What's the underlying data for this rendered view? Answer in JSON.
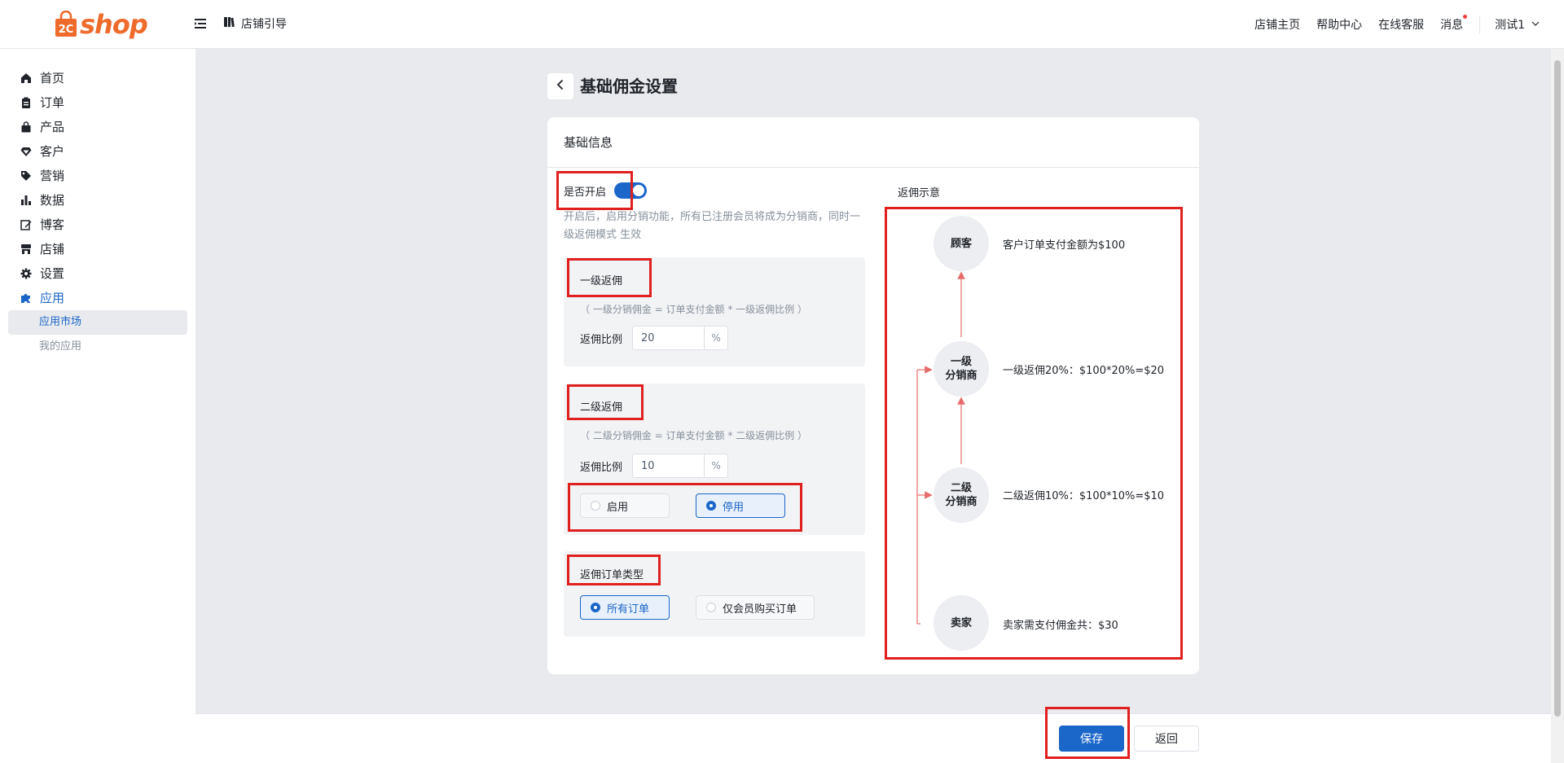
{
  "topbar": {
    "logo_text": "shop",
    "logo_mark_text": "2C",
    "guide_label": "店铺引导",
    "links": [
      "店铺主页",
      "帮助中心",
      "在线客服",
      "消息"
    ],
    "user_name": "测试1"
  },
  "sidebar": {
    "items": [
      {
        "label": "首页",
        "icon": "home-icon"
      },
      {
        "label": "订单",
        "icon": "clipboard-icon"
      },
      {
        "label": "产品",
        "icon": "bag-icon"
      },
      {
        "label": "客户",
        "icon": "diamond-icon"
      },
      {
        "label": "营销",
        "icon": "tag-icon"
      },
      {
        "label": "数据",
        "icon": "bar-chart-icon"
      },
      {
        "label": "博客",
        "icon": "edit-icon"
      },
      {
        "label": "店铺",
        "icon": "store-icon"
      },
      {
        "label": "设置",
        "icon": "gear-icon"
      },
      {
        "label": "应用",
        "icon": "puzzle-icon"
      }
    ],
    "sub_items": [
      {
        "label": "应用市场",
        "active": true
      },
      {
        "label": "我的应用",
        "active": false
      }
    ]
  },
  "page": {
    "title": "基础佣金设置"
  },
  "card": {
    "title": "基础信息",
    "enable_label": "是否开启",
    "enable_on": true,
    "enable_desc": "开启后，启用分销功能，所有已注册会员将成为分销商，同时一级返佣模式 生效",
    "level1": {
      "title": "一级返佣",
      "formula": "（ 一级分销佣金 = 订单支付金额 * 一级返佣比例 ）",
      "rate_label": "返佣比例",
      "rate_value": "20",
      "unit": "%"
    },
    "level2": {
      "title": "二级返佣",
      "formula": "（ 二级分销佣金 = 订单支付金额 * 二级返佣比例 ）",
      "rate_label": "返佣比例",
      "rate_value": "10",
      "unit": "%",
      "options": [
        "启用",
        "停用"
      ],
      "selected": "停用"
    },
    "order_type": {
      "title": "返佣订单类型",
      "options": [
        "所有订单",
        "仅会员购买订单"
      ],
      "selected": "所有订单"
    }
  },
  "diagram": {
    "title": "返佣示意",
    "nodes": [
      {
        "label_line1": "顾客",
        "label_line2": "",
        "desc": "客户订单支付金额为$100"
      },
      {
        "label_line1": "一级",
        "label_line2": "分销商",
        "desc": "一级返佣20%：$100*20%=$20"
      },
      {
        "label_line1": "二级",
        "label_line2": "分销商",
        "desc": "二级返佣10%：$100*10%=$10"
      },
      {
        "label_line1": "卖家",
        "label_line2": "",
        "desc": "卖家需支付佣金共：$30"
      }
    ],
    "colors": {
      "arrow": "#e86b6b",
      "highlight": "#e0201e"
    }
  },
  "footer": {
    "save_label": "保存",
    "return_label": "返回"
  },
  "colors": {
    "primary": "#1b66c9",
    "brand": "#ef6b2c",
    "highlight": "#e0201e"
  }
}
